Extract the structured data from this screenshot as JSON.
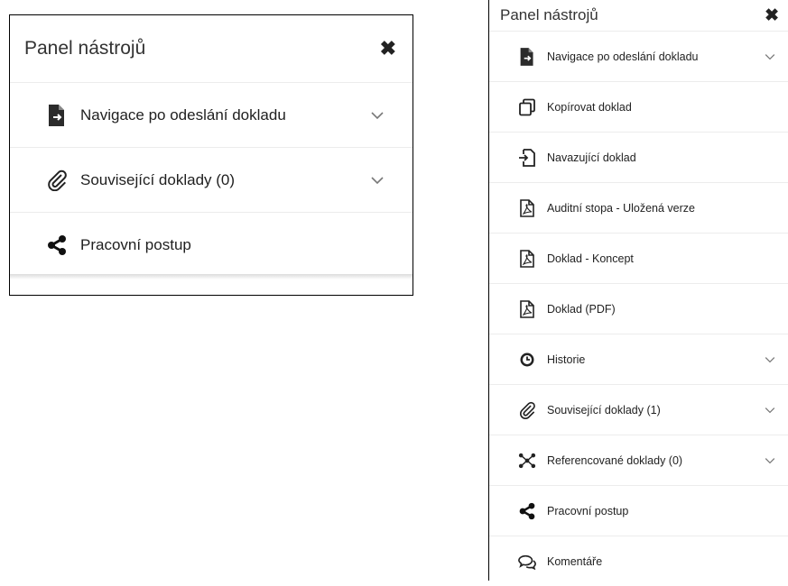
{
  "left_panel": {
    "title": "Panel nástrojů",
    "close_icon": "close-icon",
    "items": [
      {
        "label": "Navigace po odeslání dokladu",
        "icon": "document-export-icon",
        "expandable": true
      },
      {
        "label": "Související doklady (0)",
        "icon": "paperclip-icon",
        "expandable": true
      },
      {
        "label": "Pracovní postup",
        "icon": "share-nodes-icon",
        "expandable": false
      }
    ]
  },
  "right_panel": {
    "title": "Panel nástrojů",
    "close_icon": "close-icon",
    "items": [
      {
        "label": "Navigace po odeslání dokladu",
        "icon": "document-export-icon",
        "expandable": true
      },
      {
        "label": "Kopírovat doklad",
        "icon": "copy-icon",
        "expandable": false
      },
      {
        "label": "Navazující doklad",
        "icon": "file-import-icon",
        "expandable": false
      },
      {
        "label": "Auditní stopa - Uložená verze",
        "icon": "pdf-file-icon",
        "expandable": false
      },
      {
        "label": "Doklad - Koncept",
        "icon": "pdf-file-icon",
        "expandable": false
      },
      {
        "label": "Doklad (PDF)",
        "icon": "pdf-file-icon",
        "expandable": false
      },
      {
        "label": "Historie",
        "icon": "clock-icon",
        "expandable": true
      },
      {
        "label": "Související doklady (1)",
        "icon": "paperclip-icon",
        "expandable": true
      },
      {
        "label": "Referencované doklady (0)",
        "icon": "network-icon",
        "expandable": true
      },
      {
        "label": "Pracovní postup",
        "icon": "share-nodes-icon",
        "expandable": false
      },
      {
        "label": "Komentáře",
        "icon": "comments-icon",
        "expandable": false
      }
    ]
  }
}
